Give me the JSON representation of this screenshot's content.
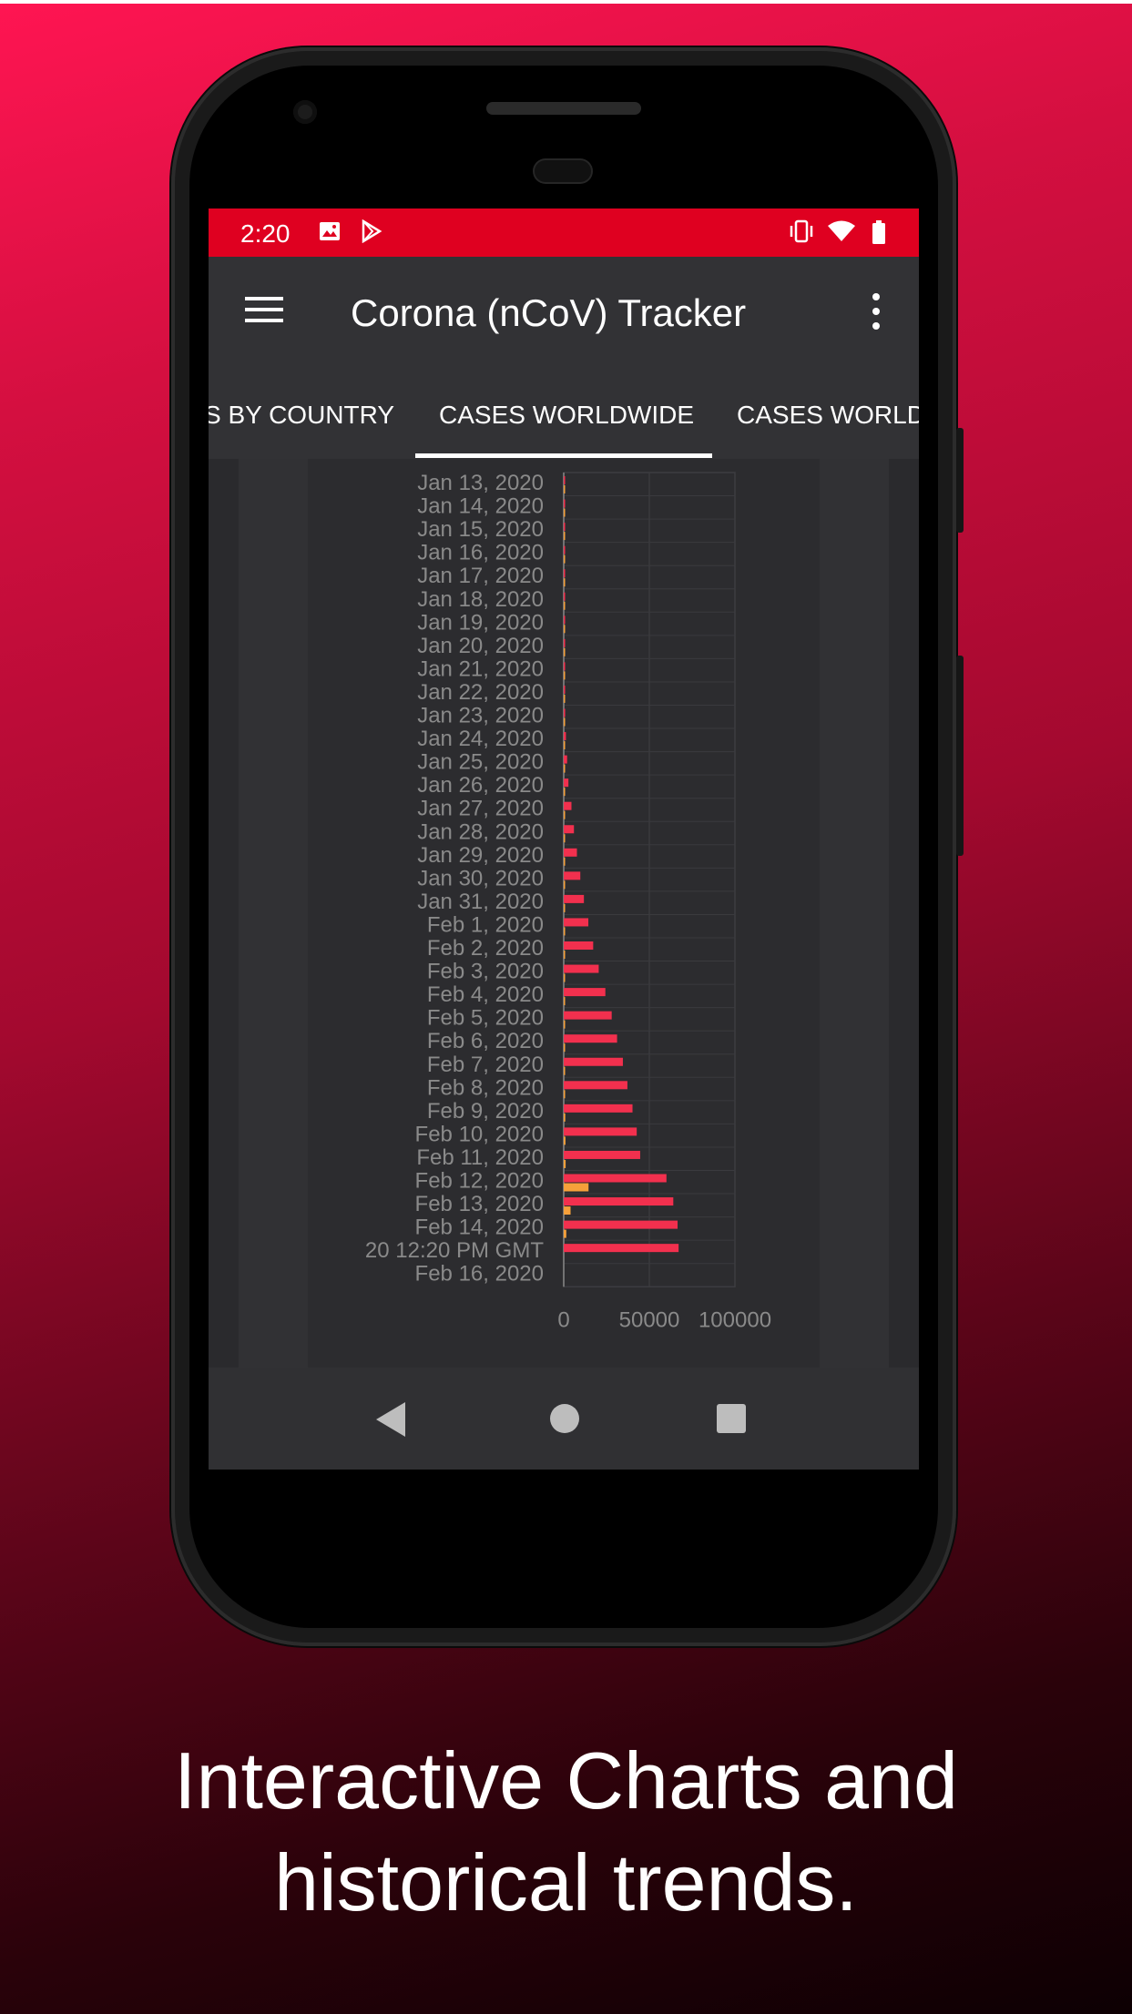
{
  "status_bar": {
    "time": "2:20",
    "left_icons": [
      "image-icon",
      "play-store-icon"
    ],
    "right_icons": [
      "vibrate-icon",
      "wifi-icon",
      "battery-icon"
    ]
  },
  "app_bar": {
    "title": "Corona (nCoV) Tracker"
  },
  "tabs": [
    {
      "label": "CASES BY COUNTRY",
      "visible_text": "S BY COUNTRY"
    },
    {
      "label": "CASES WORLDWIDE",
      "selected": true
    },
    {
      "label": "CASES WORLDWIDE",
      "visible_text": "CASES WORLD"
    }
  ],
  "chart_data": {
    "type": "bar",
    "orientation": "horizontal",
    "categories": [
      "Jan 13, 2020",
      "Jan 14, 2020",
      "Jan 15, 2020",
      "Jan 16, 2020",
      "Jan 17, 2020",
      "Jan 18, 2020",
      "Jan 19, 2020",
      "Jan 20, 2020",
      "Jan 21, 2020",
      "Jan 22, 2020",
      "Jan 23, 2020",
      "Jan 24, 2020",
      "Jan 25, 2020",
      "Jan 26, 2020",
      "Jan 27, 2020",
      "Jan 28, 2020",
      "Jan 29, 2020",
      "Jan 30, 2020",
      "Jan 31, 2020",
      "Feb 1, 2020",
      "Feb 2, 2020",
      "Feb 3, 2020",
      "Feb 4, 2020",
      "Feb 5, 2020",
      "Feb 6, 2020",
      "Feb 7, 2020",
      "Feb 8, 2020",
      "Feb 9, 2020",
      "Feb 10, 2020",
      "Feb 11, 2020",
      "Feb 12, 2020",
      "Feb 13, 2020",
      "Feb 14, 2020",
      "20  12:20 PM GMT",
      "Feb 16, 2020"
    ],
    "series": [
      {
        "color": "#f2304e",
        "values": [
          41,
          41,
          41,
          45,
          62,
          121,
          198,
          291,
          440,
          571,
          830,
          1287,
          1975,
          2744,
          4515,
          5974,
          7711,
          9692,
          11791,
          14380,
          17205,
          20438,
          24324,
          28018,
          31161,
          34546,
          37198,
          40171,
          42638,
          44653,
          60000,
          64000,
          66500,
          67100,
          0
        ]
      },
      {
        "color": "#f5a03a",
        "values": [
          1,
          1,
          2,
          2,
          2,
          2,
          3,
          6,
          9,
          17,
          25,
          41,
          56,
          80,
          106,
          132,
          170,
          213,
          259,
          304,
          361,
          425,
          490,
          563,
          636,
          719,
          805,
          905,
          1013,
          1113,
          14500,
          4000,
          1500,
          0,
          0
        ]
      }
    ],
    "xticks": [
      "0",
      "50000",
      "100000"
    ],
    "xlim": [
      0,
      100000
    ],
    "grid": true
  },
  "caption": {
    "line1": "Interactive Charts and",
    "line2": "historical trends."
  }
}
